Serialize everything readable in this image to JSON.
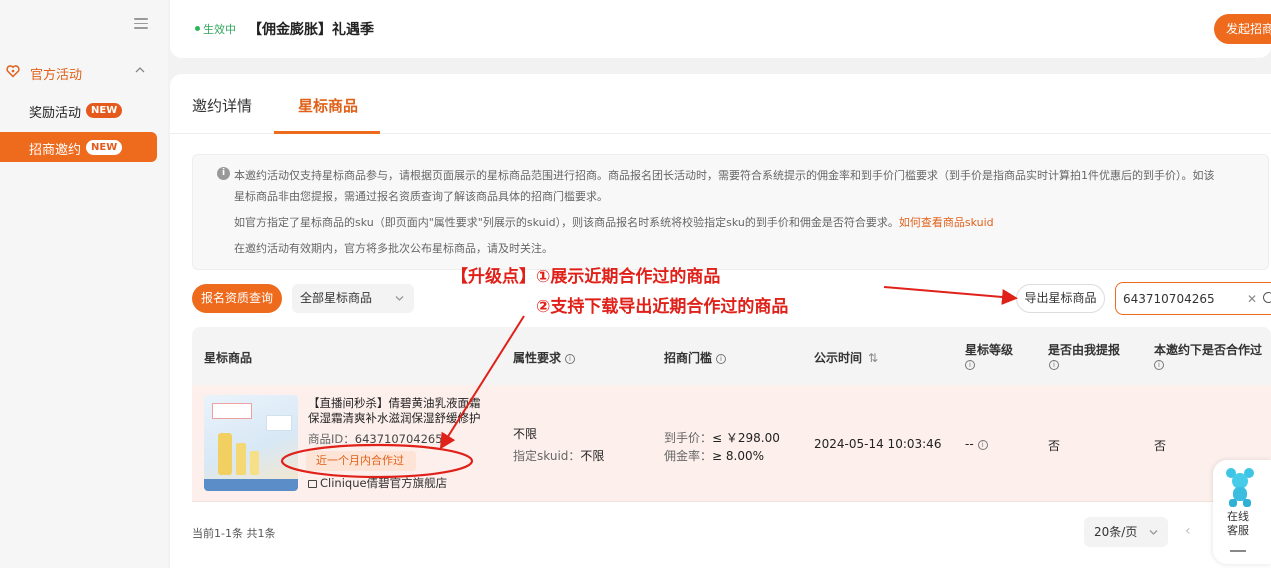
{
  "sidebar": {
    "group_label": "官方活动",
    "items": [
      {
        "label": "奖励活动",
        "badge": "NEW",
        "active": false
      },
      {
        "label": "招商邀约",
        "badge": "NEW",
        "active": true
      }
    ]
  },
  "topbar": {
    "status": "生效中",
    "title": "【佣金膨胀】礼遇季",
    "launch_button": "发起招商"
  },
  "tabs": [
    {
      "label": "邀约详情",
      "active": false
    },
    {
      "label": "星标商品",
      "active": true
    }
  ],
  "info": {
    "line1": "本邀约活动仅支持星标商品参与，请根据页面展示的星标商品范围进行招商。商品报名团长活动时，需要符合系统提示的佣金率和到手价门槛要求（到手价是指商品实时计算拍1件优惠后的到手价）。如该",
    "line2": "星标商品非由您提报，需通过报名资质查询了解该商品具体的招商门槛要求。",
    "line3": "如官方指定了星标商品的sku（即页面内\"属性要求\"列展示的skuid），则该商品报名时系统将校验指定sku的到手价和佣金是否符合要求。",
    "line3_link": "如何查看商品skuid",
    "line4": "在邀约活动有效期内，官方将多批次公布星标商品，请及时关注。"
  },
  "toolbar": {
    "qualification_button": "报名资质查询",
    "filter_value": "全部星标商品",
    "export_button": "导出星标商品",
    "search_value": "643710704265",
    "clear_symbol": "✕"
  },
  "table": {
    "headers": {
      "product": "星标商品",
      "attr": "属性要求",
      "threshold": "招商门槛",
      "publish_time": "公示时间",
      "star_level": "星标等级",
      "self_submitted": "是否由我提报",
      "cooperated": "本邀约下是否合作过"
    },
    "row": {
      "title": "【直播间秒杀】倩碧黄油乳液面霜保湿霜清爽补水滋润保湿舒缓修护",
      "id_label": "商品ID：",
      "id_value": "643710704265",
      "coop_tag": "近一个月内合作过",
      "shop": "Clinique倩碧官方旗舰店",
      "attr_value": "不限",
      "sku_label": "指定skuid：",
      "sku_value": "不限",
      "price_label": "到手价：",
      "price_value": "≤ ￥298.00",
      "commission_label": "佣金率：",
      "commission_value": "≥ 8.00%",
      "publish_time": "2024-05-14 10:03:46",
      "star_level": "--",
      "self_submitted": "否",
      "cooperated": "否"
    }
  },
  "pagination": {
    "summary": "当前1-1条 共1条",
    "page_size": "20条/页"
  },
  "annotations": {
    "line1": "【升级点】①展示近期合作过的商品",
    "line2": "②支持下载导出近期合作过的商品"
  },
  "service_widget": {
    "line1": "在线",
    "line2": "客服"
  },
  "colors": {
    "accent": "#ee6a1c",
    "annotation_red": "#e0211a",
    "status_green": "#2ea85c",
    "row_highlight": "#fdf0ec"
  }
}
